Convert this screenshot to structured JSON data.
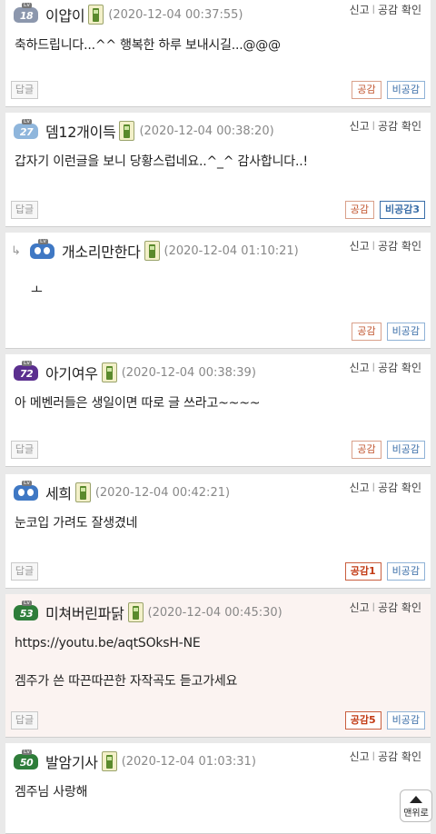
{
  "ui": {
    "report": "신고",
    "separator": "l",
    "like_check": "공감 확인",
    "reply": "답글",
    "scroll_top": "맨위로"
  },
  "comments": [
    {
      "level": "18",
      "level_color": "#8c97ad",
      "nick": "이얍이",
      "date": "(2020-12-04 00:37:55)",
      "lines": [
        "축하드립니다...^^ 행복한 하루 보내시길...@@@"
      ],
      "up": "공감",
      "down": "비공감",
      "reply": true
    },
    {
      "level": "27",
      "level_color": "#8fb6dc",
      "nick": "뎀12개이득",
      "date": "(2020-12-04 00:38:20)",
      "lines": [
        "갑자기 이런글을 보니 당황스럽네요..^_^ 감사합니다..!"
      ],
      "up": "공감",
      "down": "비공감3",
      "reply": true
    },
    {
      "level": "",
      "level_color": "#3f78c4",
      "nick": "개소리만한다",
      "date": "(2020-12-04 01:10:21)",
      "lines": [
        "ㅗ"
      ],
      "up": "공감",
      "down": "비공감",
      "reply": false
    },
    {
      "level": "72",
      "level_color": "#5b2f8f",
      "nick": "아기여우",
      "date": "(2020-12-04 00:38:39)",
      "lines": [
        "아 메벤러들은 생일이면 따로 글 쓰라고~~~~"
      ],
      "up": "공감",
      "down": "비공감",
      "reply": true
    },
    {
      "level": "",
      "level_color": "#3f78c4",
      "nick": "세희",
      "date": "(2020-12-04 00:42:21)",
      "lines": [
        "눈코입 가려도 잘생겼네"
      ],
      "up": "공감1",
      "down": "비공감",
      "reply": true
    },
    {
      "level": "53",
      "level_color": "#2e7d3a",
      "nick": "미쳐버린파닭",
      "date": "(2020-12-04 00:45:30)",
      "lines": [
        "https://youtu.be/aqtSOksH-NE",
        "겜주가 쓴 따끈따끈한 자작곡도 듣고가세요"
      ],
      "up": "공감5",
      "down": "비공감",
      "reply": true
    },
    {
      "level": "50",
      "level_color": "#2e7d3a",
      "nick": "발암기사",
      "date": "(2020-12-04 01:03:31)",
      "lines": [
        "겜주님 사랑해"
      ],
      "up": "",
      "down": "",
      "reply": false
    }
  ]
}
